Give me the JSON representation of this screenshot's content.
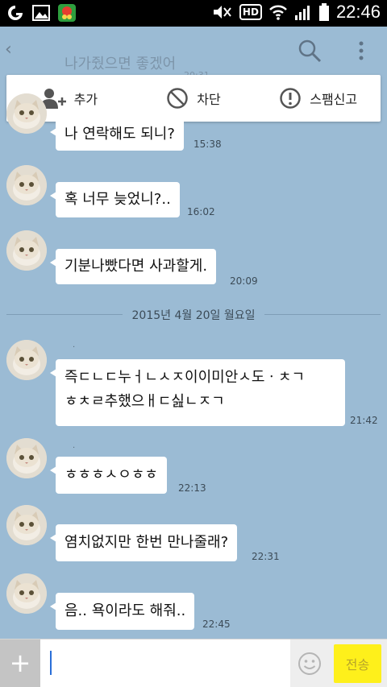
{
  "status_bar": {
    "time": "22:46",
    "network_label": "HD",
    "icons": [
      "carrier-icon",
      "image-notification-icon",
      "app-notification-icon",
      "mute-icon",
      "wifi-icon",
      "signal-icon",
      "battery-icon"
    ]
  },
  "header": {
    "back_label": "‹",
    "title": "나가줬으면 좋겠어",
    "time_partial": "20:31",
    "search_icon": "search-icon",
    "more_icon": "more-vertical-icon"
  },
  "actions": [
    {
      "label": "추가",
      "icon": "add-friend-icon"
    },
    {
      "label": "차단",
      "icon": "block-icon"
    },
    {
      "label": "스팸신고",
      "icon": "report-spam-icon"
    }
  ],
  "messages": [
    {
      "text": "나 연락해도 되니?",
      "time": "15:38"
    },
    {
      "text": "혹 너무 늦었니?..",
      "time": "16:02"
    },
    {
      "text": "기분나빴다면 사과할게.",
      "time": "20:09"
    },
    {
      "text_line1": "즉ㄷㄴㄷ누ㅓㄴㅅㅈ이이미안ㅅ도ㆍㅊㄱ",
      "text_line2": "ㅎㅊㄹ추했으ㅐㄷ싪ㄴㅈㄱ",
      "time": "21:42"
    },
    {
      "text": "ㅎㅎㅎㅅㅇㅎㅎ",
      "time": "22:13"
    },
    {
      "text": "염치없지만 한번 만나줄래?",
      "time": "22:31"
    },
    {
      "text": "음.. 욕이라도 해줘..",
      "time": "22:45"
    }
  ],
  "date_separator": "2015년 4월 20일 월요일",
  "input": {
    "plus_label": "+",
    "placeholder": "",
    "value": "",
    "emoji_icon": "emoticon-icon",
    "send_label": "전송"
  },
  "colors": {
    "chat_background": "#9bbbd4",
    "send_button": "#fef01b",
    "bubble": "#ffffff"
  }
}
